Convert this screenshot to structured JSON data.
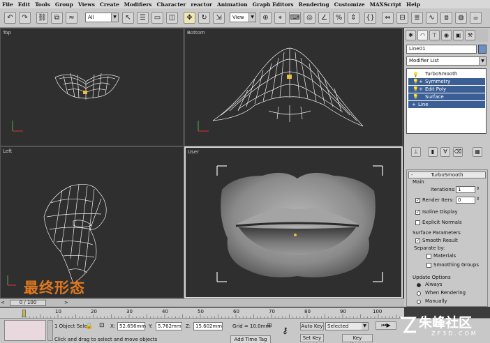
{
  "menu": [
    "File",
    "Edit",
    "Tools",
    "Group",
    "Views",
    "Create",
    "Modifiers",
    "Character",
    "reactor",
    "Animation",
    "Graph Editors",
    "Rendering",
    "Customize",
    "MAXScript",
    "Help"
  ],
  "toolbar": {
    "filter_value": "All",
    "refcoord_value": "View"
  },
  "viewports": {
    "top": "Top",
    "bottom": "Bottom",
    "left": "Left",
    "user": "User"
  },
  "caption": "最终形态",
  "panel": {
    "object_name": "Line01",
    "modifier_list": "Modifier List",
    "stack": [
      "TurboSmooth",
      "Symmetry",
      "Edit Poly",
      "Surface",
      "Line"
    ],
    "rollout_title": "TurboSmooth",
    "main_group": "Main",
    "iterations_label": "Iterations:",
    "iterations_value": "1",
    "render_iters_label": "Render Iters:",
    "render_iters_value": "0",
    "isoline": "Isoline Display",
    "explicit": "Explicit Normals",
    "surface_group": "Surface Parameters",
    "smooth_result": "Smooth Result",
    "separate_by": "Separate by:",
    "materials": "Materials",
    "smoothing_groups": "Smoothing Groups",
    "update_group": "Update Options",
    "always": "Always",
    "when_rendering": "When Rendering",
    "manually": "Manually"
  },
  "timeline": {
    "frame": "0 / 100",
    "ticks": [
      "10",
      "20",
      "30",
      "40",
      "50",
      "60",
      "70",
      "80",
      "90",
      "100"
    ]
  },
  "status": {
    "selection": "1 Object Sele",
    "x_label": "X:",
    "x_value": "52.656mm",
    "y_label": "Y:",
    "y_value": "5.762mm",
    "z_label": "Z:",
    "z_value": "15.602mm",
    "grid": "Grid = 10.0mm",
    "prompt": "Click and drag to select and move objects",
    "add_time_tag": "Add Time Tag",
    "auto_key": "Auto Key",
    "selected": "Selected",
    "set_key": "Set Key",
    "key_filters": "Key Filters..."
  },
  "watermark": {
    "name": "朱峰社区",
    "url": "ZF3D.COM"
  }
}
